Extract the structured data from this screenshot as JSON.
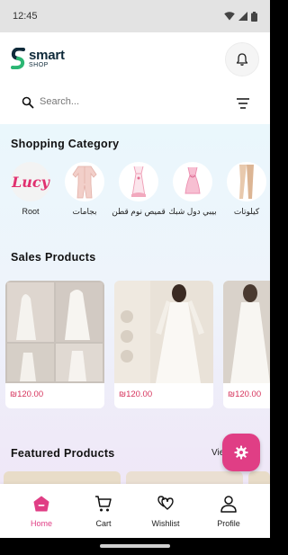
{
  "status": {
    "time": "12:45"
  },
  "header": {
    "logo_main": "smart",
    "logo_sub": "SHOP"
  },
  "search": {
    "placeholder": "Search..."
  },
  "categories": {
    "title": "Shopping Category",
    "items": [
      {
        "label": "Root",
        "logo_text": "Lucy"
      },
      {
        "label": "بجامات"
      },
      {
        "label": "قميص نوم قطن"
      },
      {
        "label": "بيبي دول شبك"
      },
      {
        "label": "كيلوتات"
      }
    ]
  },
  "sales": {
    "title": "Sales Products",
    "items": [
      {
        "price": "₪120.00"
      },
      {
        "price": "₪120.00"
      },
      {
        "price": "₪120.00"
      }
    ]
  },
  "featured": {
    "title": "Featured Products",
    "view_all": "View All"
  },
  "nav": {
    "items": [
      {
        "label": "Home"
      },
      {
        "label": "Cart"
      },
      {
        "label": "Wishlist"
      },
      {
        "label": "Profile"
      }
    ]
  },
  "colors": {
    "accent": "#e03e85",
    "price": "#d6335c",
    "logo": "#0f2a3a",
    "logo_accent": "#2bb673"
  }
}
